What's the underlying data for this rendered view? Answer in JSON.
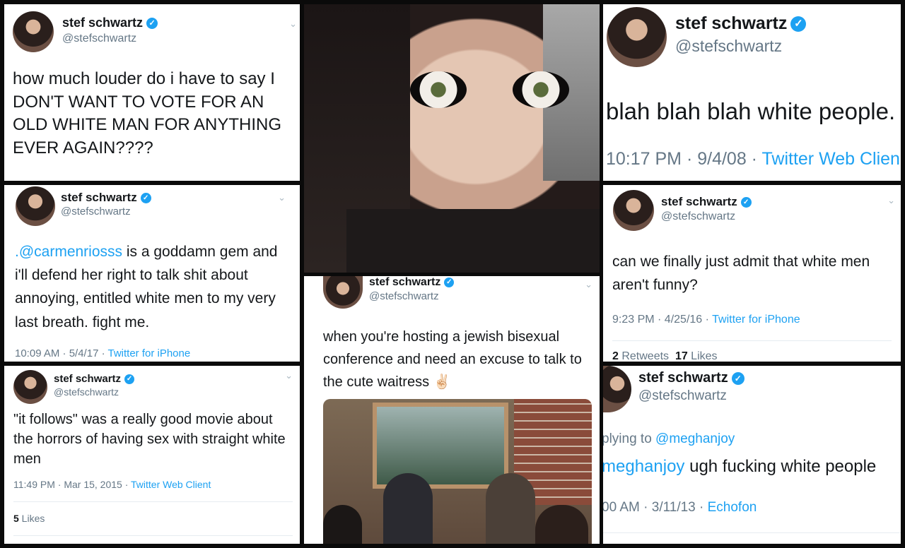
{
  "profile": {
    "name": "stef schwartz",
    "handle": "@stefschwartz",
    "verified_color": "#1da1f2"
  },
  "tweets": [
    {
      "text": "how much louder do i have to say I DON'T WANT TO VOTE FOR AN OLD WHITE MAN FOR ANYTHING EVER AGAIN????"
    },
    {
      "text": "blah blah blah white people.",
      "time": "10:17 PM · 9/4/08 · ",
      "source": "Twitter Web Clien"
    },
    {
      "mention": ".@carmenriosss",
      "text": " is a goddamn gem and i'll defend her right to talk shit about annoying, entitled white men to my very last breath. fight me.",
      "time": "10:09 AM · 5/4/17 · ",
      "source": "Twitter for iPhone"
    },
    {
      "text": "can we finally just admit that white men aren't funny?",
      "time": "9:23 PM · 4/25/16 · ",
      "source": "Twitter for iPhone",
      "retweets": "2",
      "retweets_label": " Retweets  ",
      "likes": "17",
      "likes_label": " Likes"
    },
    {
      "text": "when you're hosting a jewish bisexual conference and need an excuse to talk to the cute waitress ✌🏻"
    },
    {
      "text": "\"it follows\" was a really good movie about the horrors of having sex with straight white men",
      "time": "11:49 PM · Mar 15, 2015 · ",
      "source": "Twitter Web Client",
      "likes": "5",
      "likes_label": " Likes"
    },
    {
      "reply_prefix": "plying to ",
      "reply_to": "@meghanjoy",
      "mention": "meghanjoy",
      "text": " ugh fucking white people",
      "time": "00 AM · 3/11/13 · ",
      "source": "Echofon"
    }
  ]
}
